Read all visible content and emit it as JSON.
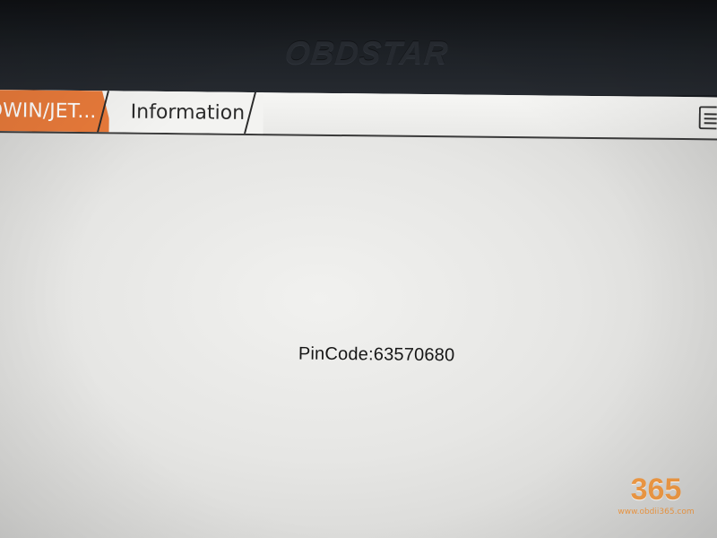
{
  "device": {
    "brand": "OBDSTAR"
  },
  "tabs": [
    {
      "label": "OWIN/JET..."
    },
    {
      "label": "Information"
    }
  ],
  "content": {
    "pincode_text": "PinCode:63570680"
  },
  "watermark": {
    "digits": "365",
    "url": "www.obdii365.com"
  },
  "colors": {
    "accent": "#e87a3a",
    "watermark": "#f19a44"
  },
  "icons": {
    "report": "report-icon"
  }
}
